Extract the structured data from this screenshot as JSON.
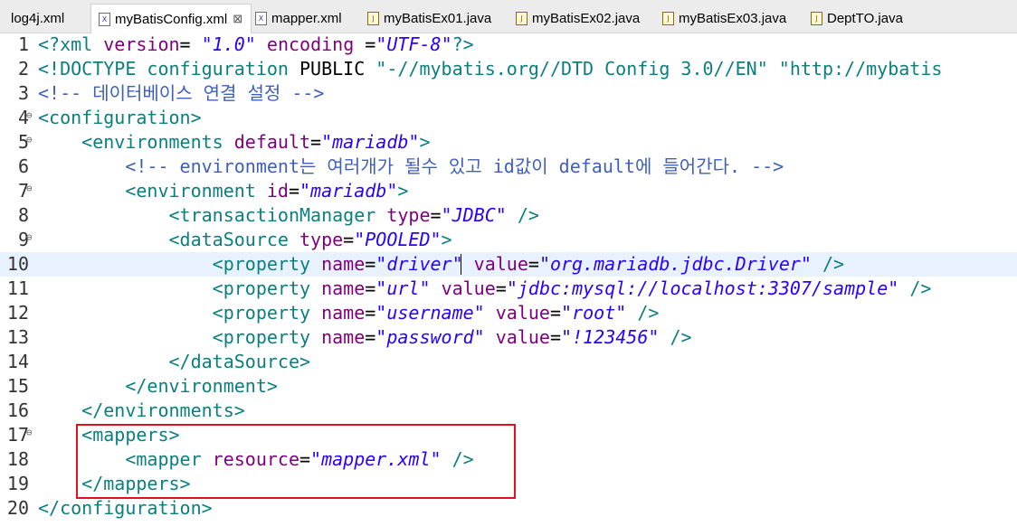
{
  "tabs": [
    {
      "label": "log4j.xml",
      "icon": "",
      "active": false,
      "closable": false
    },
    {
      "label": "myBatisConfig.xml",
      "icon": "xml-file-icon",
      "active": true,
      "closable": true
    },
    {
      "label": "mapper.xml",
      "icon": "xml-file-icon",
      "active": false,
      "closable": false
    },
    {
      "label": "myBatisEx01.java",
      "icon": "java-file-icon",
      "active": false,
      "closable": false
    },
    {
      "label": "myBatisEx02.java",
      "icon": "java-file-icon",
      "active": false,
      "closable": false
    },
    {
      "label": "myBatisEx03.java",
      "icon": "java-file-icon",
      "active": false,
      "closable": false
    },
    {
      "label": "DeptTO.java",
      "icon": "java-file-icon",
      "active": false,
      "closable": false
    }
  ],
  "tab_close_glyph": "⊠",
  "editor": {
    "current_line": 10,
    "highlighted_lines": [
      17,
      18,
      19
    ],
    "lines": [
      {
        "n": "1",
        "fold": false,
        "parts": [
          [
            "t",
            "<?xml "
          ],
          [
            "a",
            "version"
          ],
          [
            "p",
            "= "
          ],
          [
            "v",
            "\"1.0\""
          ],
          [
            "p",
            " "
          ],
          [
            "a",
            "encoding"
          ],
          [
            "p",
            " ="
          ],
          [
            "v",
            "\"UTF-8\""
          ],
          [
            "t",
            "?>"
          ]
        ]
      },
      {
        "n": "2",
        "fold": false,
        "parts": [
          [
            "t",
            "<!DOCTYPE configuration "
          ],
          [
            "p",
            "PUBLIC "
          ],
          [
            "t",
            "\"-//mybatis.org//DTD Config 3.0//EN\" \"http://mybatis"
          ]
        ]
      },
      {
        "n": "3",
        "fold": false,
        "parts": [
          [
            "c",
            "<!-- 데이터베이스 연결 설정 -->"
          ]
        ]
      },
      {
        "n": "4",
        "fold": true,
        "parts": [
          [
            "t",
            "<configuration>"
          ]
        ]
      },
      {
        "n": "5",
        "fold": true,
        "parts": [
          [
            "p",
            "    "
          ],
          [
            "t",
            "<environments "
          ],
          [
            "a",
            "default"
          ],
          [
            "p",
            "="
          ],
          [
            "v",
            "\"mariadb\""
          ],
          [
            "t",
            ">"
          ]
        ]
      },
      {
        "n": "6",
        "fold": false,
        "parts": [
          [
            "p",
            "        "
          ],
          [
            "c",
            "<!-- environment는 여러개가 될수 있고 id값이 default에 들어간다. -->"
          ]
        ]
      },
      {
        "n": "7",
        "fold": true,
        "parts": [
          [
            "p",
            "        "
          ],
          [
            "t",
            "<environment "
          ],
          [
            "a",
            "id"
          ],
          [
            "p",
            "="
          ],
          [
            "v",
            "\"mariadb\""
          ],
          [
            "t",
            ">"
          ]
        ]
      },
      {
        "n": "8",
        "fold": false,
        "parts": [
          [
            "p",
            "            "
          ],
          [
            "t",
            "<transactionManager "
          ],
          [
            "a",
            "type"
          ],
          [
            "p",
            "="
          ],
          [
            "v",
            "\"JDBC\""
          ],
          [
            "p",
            " "
          ],
          [
            "t",
            "/>"
          ]
        ]
      },
      {
        "n": "9",
        "fold": true,
        "parts": [
          [
            "p",
            "            "
          ],
          [
            "t",
            "<dataSource "
          ],
          [
            "a",
            "type"
          ],
          [
            "p",
            "="
          ],
          [
            "v",
            "\"POOLED\""
          ],
          [
            "t",
            ">"
          ]
        ]
      },
      {
        "n": "10",
        "fold": false,
        "parts": [
          [
            "p",
            "                "
          ],
          [
            "t",
            "<property "
          ],
          [
            "a",
            "name"
          ],
          [
            "p",
            "="
          ],
          [
            "v",
            "\"driver\""
          ],
          [
            "p",
            " "
          ],
          [
            "a",
            "value"
          ],
          [
            "p",
            "="
          ],
          [
            "v",
            "\"org.mariadb.jdbc.Driver\""
          ],
          [
            "p",
            " "
          ],
          [
            "t",
            "/>"
          ]
        ]
      },
      {
        "n": "11",
        "fold": false,
        "parts": [
          [
            "p",
            "                "
          ],
          [
            "t",
            "<property "
          ],
          [
            "a",
            "name"
          ],
          [
            "p",
            "="
          ],
          [
            "v",
            "\"url\""
          ],
          [
            "p",
            " "
          ],
          [
            "a",
            "value"
          ],
          [
            "p",
            "="
          ],
          [
            "v",
            "\"jdbc:mysql://localhost:3307/sample\""
          ],
          [
            "p",
            " "
          ],
          [
            "t",
            "/>"
          ]
        ]
      },
      {
        "n": "12",
        "fold": false,
        "parts": [
          [
            "p",
            "                "
          ],
          [
            "t",
            "<property "
          ],
          [
            "a",
            "name"
          ],
          [
            "p",
            "="
          ],
          [
            "v",
            "\"username\""
          ],
          [
            "p",
            " "
          ],
          [
            "a",
            "value"
          ],
          [
            "p",
            "="
          ],
          [
            "v",
            "\"root\""
          ],
          [
            "p",
            " "
          ],
          [
            "t",
            "/>"
          ]
        ]
      },
      {
        "n": "13",
        "fold": false,
        "parts": [
          [
            "p",
            "                "
          ],
          [
            "t",
            "<property "
          ],
          [
            "a",
            "name"
          ],
          [
            "p",
            "="
          ],
          [
            "v",
            "\"password\""
          ],
          [
            "p",
            " "
          ],
          [
            "a",
            "value"
          ],
          [
            "p",
            "="
          ],
          [
            "v",
            "\"!123456\""
          ],
          [
            "p",
            " "
          ],
          [
            "t",
            "/>"
          ]
        ]
      },
      {
        "n": "14",
        "fold": false,
        "parts": [
          [
            "p",
            "            "
          ],
          [
            "t",
            "</dataSource>"
          ]
        ]
      },
      {
        "n": "15",
        "fold": false,
        "parts": [
          [
            "p",
            "        "
          ],
          [
            "t",
            "</environment>"
          ]
        ]
      },
      {
        "n": "16",
        "fold": false,
        "parts": [
          [
            "p",
            "    "
          ],
          [
            "t",
            "</environments>"
          ]
        ]
      },
      {
        "n": "17",
        "fold": true,
        "parts": [
          [
            "p",
            "    "
          ],
          [
            "t",
            "<mappers>"
          ]
        ]
      },
      {
        "n": "18",
        "fold": false,
        "parts": [
          [
            "p",
            "        "
          ],
          [
            "t",
            "<mapper "
          ],
          [
            "a",
            "resource"
          ],
          [
            "p",
            "="
          ],
          [
            "v",
            "\"mapper.xml\""
          ],
          [
            "p",
            " "
          ],
          [
            "t",
            "/>"
          ]
        ]
      },
      {
        "n": "19",
        "fold": false,
        "parts": [
          [
            "p",
            "    "
          ],
          [
            "t",
            "</mappers>"
          ]
        ]
      },
      {
        "n": "20",
        "fold": false,
        "parts": [
          [
            "t",
            "</configuration>"
          ]
        ]
      }
    ]
  },
  "colors": {
    "tag": "#0b7f7f",
    "attribute": "#7f007f",
    "value": "#2a00ff",
    "comment": "#3f5fbf",
    "highlight_box": "#e0121e",
    "current_line_bg": "#e8f2fe"
  }
}
